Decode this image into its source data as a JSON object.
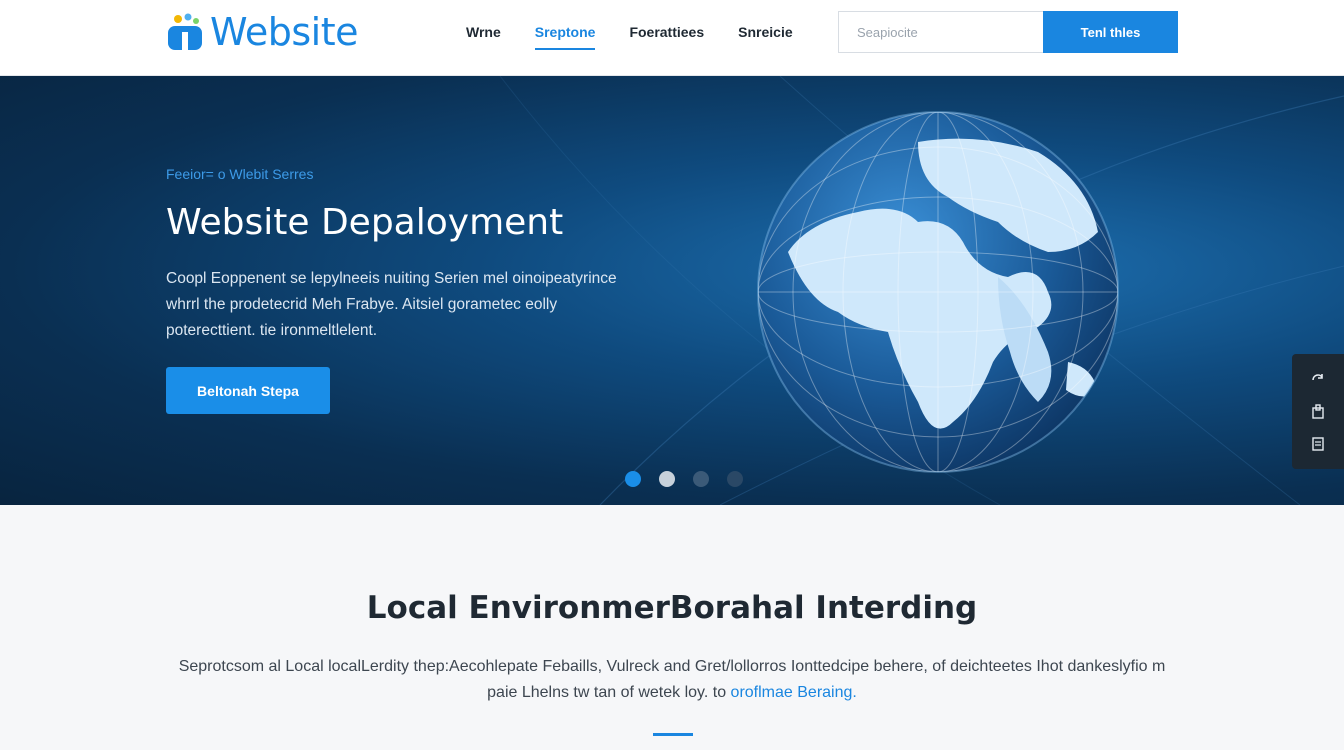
{
  "header": {
    "logo_text": "Website",
    "nav": [
      "Wrne",
      "Sreptone",
      "Foerattiees",
      "Snreicie"
    ],
    "active_nav": 1,
    "search_placeholder": "Seapiocite",
    "search_button": "Tenl thles"
  },
  "hero": {
    "eyebrow": "Feeior= o Wlebit Serres",
    "title": "Website Depaloyment",
    "description": "Coopl Eoppenent se lepylneeis nuiting Serien mel oinoipeatyrince whrrl the prodetecrid Meh Frabye. Aitsiel gorametec eolly poterecttient. tie ironmeltlelent.",
    "cta": "Beltonah Stepa",
    "slides": 4,
    "active_slide": 0
  },
  "side_toolbar": {
    "icons": [
      "refresh-icon",
      "save-icon",
      "document-icon"
    ]
  },
  "section": {
    "title": "Local EnvironmerBorahal Interding",
    "description": "Seprotcsom al Local localLerdity thep:Aecohlepate Febaills, Vulreck and Gret/lollorros Ionttedcipe behere, of deichteetes Ihot dankeslyfio m paie Lhelns tw tan of wetek loy. to",
    "link": "oroflmae Beraing."
  },
  "colors": {
    "accent": "#1a86e0",
    "hero_dark": "#0a2f52",
    "toolbar": "#1c2833"
  }
}
